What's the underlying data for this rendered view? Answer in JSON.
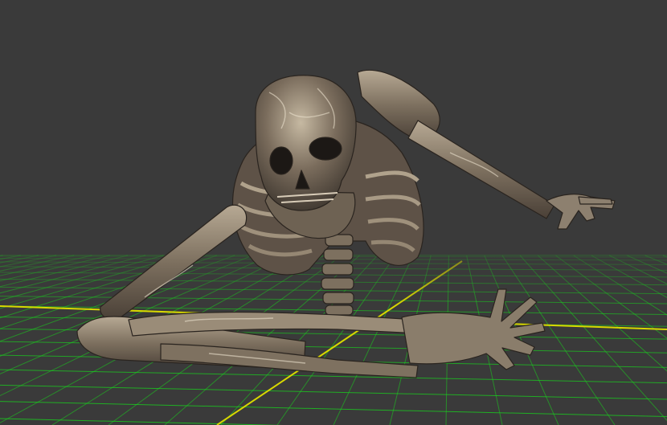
{
  "viewport": {
    "background": "#3a3a3a",
    "grid_color": "#19d21e",
    "axis_color": "#d8d800",
    "model": "skeleton-icon",
    "bone_color": "#8b7e6e"
  }
}
